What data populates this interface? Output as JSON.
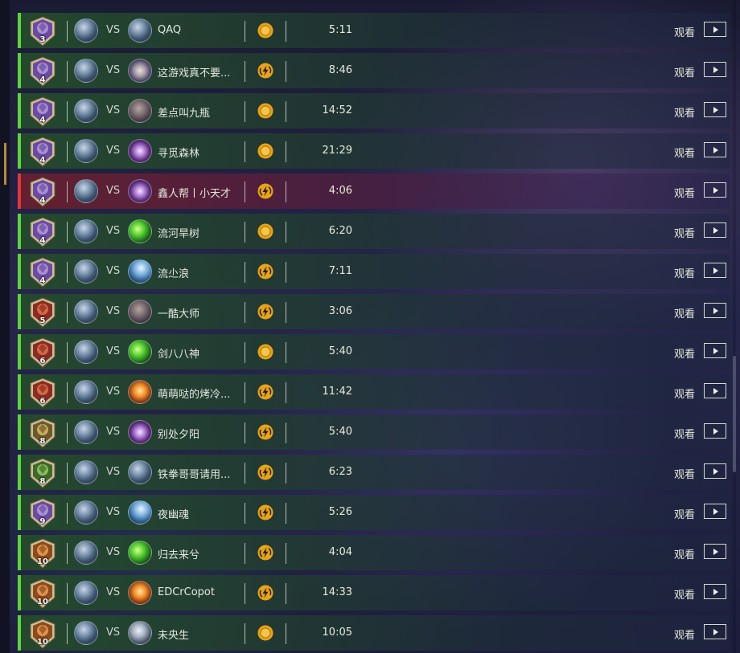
{
  "matches": [
    {
      "rank": "3",
      "opponent": "QAQ",
      "duration": "5:11",
      "first": "coin",
      "result": "win",
      "opp_avatar": "mech-box",
      "rank_style": "purple"
    },
    {
      "rank": "4",
      "opponent": "这游戏真不要...",
      "duration": "8:46",
      "first": "turn",
      "result": "win",
      "opp_avatar": "sword-spiral",
      "rank_style": "purple"
    },
    {
      "rank": "4",
      "opponent": "差点叫九瓶",
      "duration": "14:52",
      "first": "coin",
      "result": "win",
      "opp_avatar": "stone-face",
      "rank_style": "purple"
    },
    {
      "rank": "4",
      "opponent": "寻觅森林",
      "duration": "21:29",
      "first": "coin",
      "result": "win",
      "opp_avatar": "purple-star",
      "rank_style": "purple"
    },
    {
      "rank": "4",
      "opponent": "鑫人帮丨小天才",
      "duration": "4:06",
      "first": "turn",
      "result": "loss",
      "opp_avatar": "purple-star",
      "rank_style": "purple"
    },
    {
      "rank": "4",
      "opponent": "流河旱树",
      "duration": "6:20",
      "first": "coin",
      "result": "win",
      "opp_avatar": "green-orb",
      "rank_style": "purple"
    },
    {
      "rank": "4",
      "opponent": "流尐浪",
      "duration": "7:11",
      "first": "turn",
      "result": "win",
      "opp_avatar": "blue-sword",
      "rank_style": "purple"
    },
    {
      "rank": "5",
      "opponent": "一酷大师",
      "duration": "3:06",
      "first": "turn",
      "result": "win",
      "opp_avatar": "stone-face",
      "rank_style": "red"
    },
    {
      "rank": "6",
      "opponent": "剑八八神",
      "duration": "5:40",
      "first": "coin",
      "result": "win",
      "opp_avatar": "green-orb",
      "rank_style": "red"
    },
    {
      "rank": "6",
      "opponent": "萌萌哒的烤冷...",
      "duration": "11:42",
      "first": "turn",
      "result": "win",
      "opp_avatar": "fire-orb",
      "rank_style": "red"
    },
    {
      "rank": "8",
      "opponent": "别处夕阳",
      "duration": "5:40",
      "first": "turn",
      "result": "win",
      "opp_avatar": "purple-star",
      "rank_style": "gold"
    },
    {
      "rank": "8",
      "opponent": "铁拳哥哥请用...",
      "duration": "6:23",
      "first": "turn",
      "result": "win",
      "opp_avatar": "mech-box",
      "rank_style": "green"
    },
    {
      "rank": "9",
      "opponent": "夜幽魂",
      "duration": "5:26",
      "first": "turn",
      "result": "win",
      "opp_avatar": "blue-sword",
      "rank_style": "purple"
    },
    {
      "rank": "10",
      "opponent": "归去来兮",
      "duration": "4:04",
      "first": "turn",
      "result": "win",
      "opp_avatar": "green-orb",
      "rank_style": "orange"
    },
    {
      "rank": "10",
      "opponent": "EDCrCopot",
      "duration": "14:33",
      "first": "turn",
      "result": "win",
      "opp_avatar": "fire-orb",
      "rank_style": "orange"
    },
    {
      "rank": "10",
      "opponent": "未央生",
      "duration": "10:05",
      "first": "coin",
      "result": "win",
      "opp_avatar": "steel-orb",
      "rank_style": "orange"
    }
  ],
  "labels": {
    "vs": "VS",
    "watch": "观看"
  },
  "icons": {
    "play": "play-icon",
    "coin": "coin-icon",
    "turn": "turn-icon",
    "rank": "rank-badge-icon",
    "player": "mech-box-avatar"
  },
  "colors": {
    "win": "#5cd638",
    "loss": "#e5343b",
    "coin": "#e7a418",
    "text": "#e7ead9"
  }
}
